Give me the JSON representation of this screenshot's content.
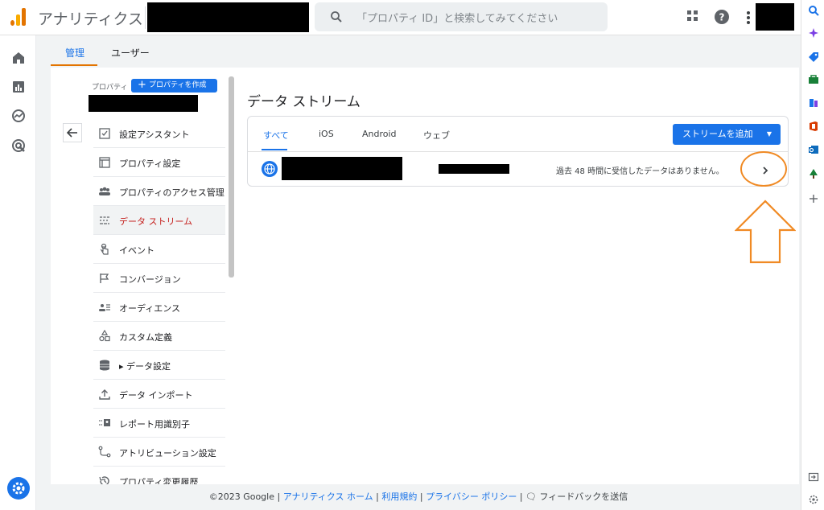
{
  "app": {
    "title": "アナリティクス"
  },
  "search": {
    "placeholder": "「プロパティ ID」と検索してみてください"
  },
  "admin_tabs": {
    "admin": "管理",
    "user": "ユーザー"
  },
  "property": {
    "label": "プロパティ",
    "create_button": "プロパティを作成"
  },
  "nav": {
    "items": [
      {
        "label": "設定アシスタント",
        "icon": "checklist-icon"
      },
      {
        "label": "プロパティ設定",
        "icon": "property-settings-icon"
      },
      {
        "label": "プロパティのアクセス管理",
        "icon": "people-icon"
      },
      {
        "label": "データ ストリーム",
        "icon": "data-streams-icon",
        "active": true
      },
      {
        "label": "イベント",
        "icon": "touch-icon"
      },
      {
        "label": "コンバージョン",
        "icon": "flag-icon"
      },
      {
        "label": "オーディエンス",
        "icon": "audience-icon"
      },
      {
        "label": "カスタム定義",
        "icon": "shapes-icon"
      },
      {
        "label": "データ設定",
        "icon": "database-icon",
        "prefix": "▸"
      },
      {
        "label": "データ インポート",
        "icon": "upload-icon"
      },
      {
        "label": "レポート用識別子",
        "icon": "identifier-icon"
      },
      {
        "label": "アトリビューション設定",
        "icon": "attribution-icon"
      },
      {
        "label": "プロパティ変更履歴",
        "icon": "history-icon"
      }
    ]
  },
  "main": {
    "title": "データ ストリーム",
    "stream_tabs": [
      "すべて",
      "iOS",
      "Android",
      "ウェブ"
    ],
    "add_stream_button": "ストリームを追加",
    "stream_row": {
      "status": "過去 48 時間に受信したデータはありません。"
    }
  },
  "footer": {
    "copyright": "©2023 Google",
    "links": [
      "アナリティクス ホーム",
      "利用規約",
      "プライバシー ポリシー"
    ],
    "feedback": "フィードバックを送信"
  },
  "colors": {
    "accent": "#1a73e8",
    "active_nav": "#c5221f",
    "annotation": "#f08a24",
    "tab_underline": "#e37400"
  }
}
